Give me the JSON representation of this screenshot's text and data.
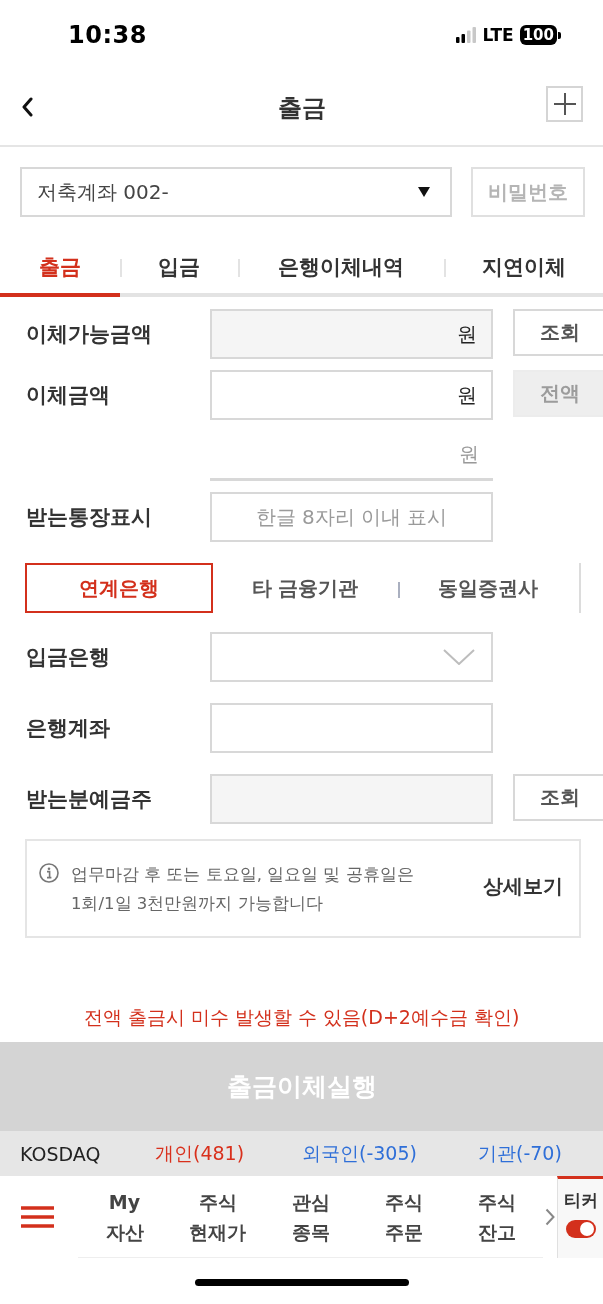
{
  "status_bar": {
    "time": "10:38",
    "network": "LTE",
    "battery": "100"
  },
  "header": {
    "title": "출금"
  },
  "account": {
    "value": "저축계좌 002-",
    "password_button": "비밀번호"
  },
  "tabs": [
    {
      "label": "출금",
      "selected": true
    },
    {
      "label": "입금",
      "selected": false
    },
    {
      "label": "은행이체내역",
      "selected": false
    },
    {
      "label": "지연이체",
      "selected": false
    }
  ],
  "form_rows": [
    {
      "kind": "readonly",
      "label": "이체가능금액",
      "unit": "원",
      "button": {
        "label": "조회",
        "disabled": false
      }
    },
    {
      "kind": "input",
      "label": "이체금액",
      "unit": "원",
      "button": {
        "label": "전액",
        "disabled": true
      }
    },
    {
      "kind": "underline",
      "unit": "원"
    },
    {
      "kind": "input",
      "label": "받는통장표시",
      "placeholder": "한글 8자리 이내 표시"
    }
  ],
  "transfer_types": [
    {
      "label": "연계은행",
      "selected": true
    },
    {
      "label": "타 금융기관",
      "selected": false
    },
    {
      "label": "동일증권사",
      "selected": false
    }
  ],
  "bank_rows": [
    {
      "kind": "select",
      "label": "입금은행"
    },
    {
      "kind": "input",
      "label": "은행계좌"
    },
    {
      "kind": "readonly",
      "label": "받는분예금주",
      "button": {
        "label": "조회",
        "disabled": false
      }
    }
  ],
  "notice": {
    "text": "업무마감 후 또는 토요일, 일요일 및 공휴일은\n1회/1일 3천만원까지 가능합니다",
    "detail_link": "상세보기"
  },
  "warning": "전액 출금시 미수 발생할 수 있음(D+2예수금 확인)",
  "execute_button": {
    "label": "출금이체실행",
    "disabled": true
  },
  "market_ticker": {
    "market": "KOSDAQ",
    "investors": [
      {
        "label": "개인(481)",
        "color": "#d9301c"
      },
      {
        "label": "외국인(-305)",
        "color": "#2f6fd8"
      },
      {
        "label": "기관(-70)",
        "color": "#2f6fd8"
      }
    ]
  },
  "bottom_nav": {
    "items": [
      {
        "label": "My\n자산"
      },
      {
        "label": "주식\n현재가"
      },
      {
        "label": "관심\n종목"
      },
      {
        "label": "주식\n주문"
      },
      {
        "label": "주식\n잔고"
      }
    ],
    "ticker": {
      "label": "티커",
      "on": true
    }
  }
}
